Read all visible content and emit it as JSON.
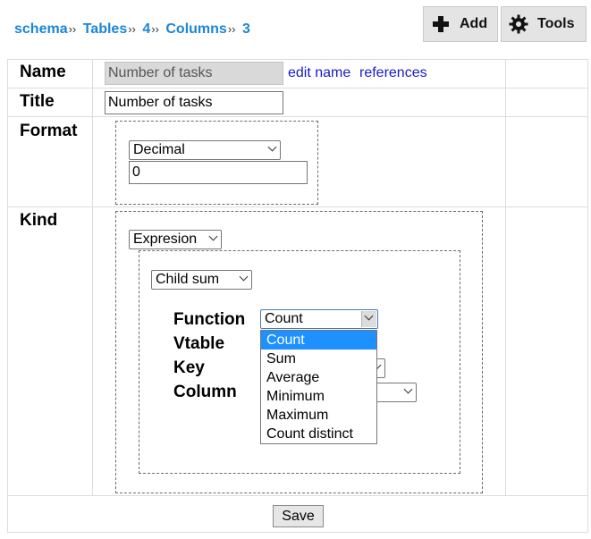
{
  "breadcrumb": {
    "items": [
      "schema",
      "Tables",
      "4",
      "Columns",
      "3"
    ],
    "separator": "››"
  },
  "toolbar": {
    "add_label": "Add",
    "add_icon": "plus-icon",
    "tools_label": "Tools",
    "tools_icon": "gear-icon"
  },
  "form": {
    "name": {
      "label": "Name",
      "value": "Number of tasks",
      "edit_link": "edit name",
      "references_link": "references"
    },
    "title": {
      "label": "Title",
      "value": "Number of tasks"
    },
    "format": {
      "label": "Format",
      "type_value": "Decimal",
      "decimals_value": "0"
    },
    "kind": {
      "label": "Kind",
      "kind_value": "Expresion",
      "expression_value": "Child sum",
      "function_label": "Function",
      "function_value": "Count",
      "vtable_label": "Vtable",
      "key_label": "Key",
      "column_label": "Column"
    }
  },
  "function_dropdown": {
    "options": [
      "Count",
      "Sum",
      "Average",
      "Minimum",
      "Maximum",
      "Count distinct"
    ],
    "highlighted": "Count"
  },
  "save_label": "Save",
  "colors": {
    "breadcrumb": "#1a86d6",
    "link": "#1a1acc",
    "highlight": "#1e90ff",
    "readonly_bg": "#d9d9d9"
  }
}
